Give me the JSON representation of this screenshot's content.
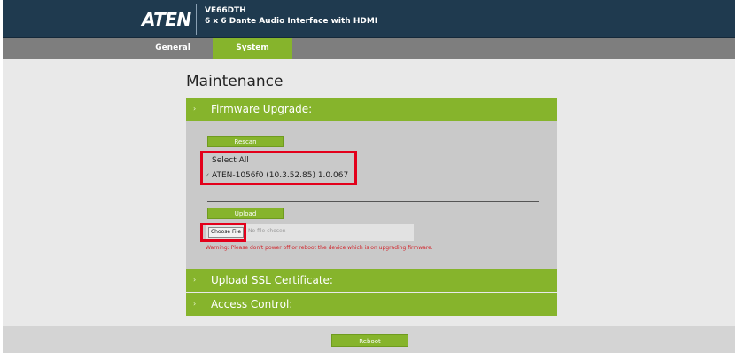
{
  "header": {
    "logo_text": "ATEN",
    "product_model": "VE66DTH",
    "product_desc": "6 x 6 Dante Audio Interface with HDMI"
  },
  "nav": {
    "tabs": [
      {
        "label": "General"
      },
      {
        "label": "System",
        "active": true
      }
    ]
  },
  "main": {
    "page_title": "Maintenance",
    "firmware": {
      "header": "Firmware Upgrade:",
      "rescan_label": "Rescan",
      "select_all_label": "Select All",
      "device_label": "ATEN-1056f0 (10.3.52.85) 1.0.067",
      "upload_label": "Upload",
      "choose_file_label": "Choose File",
      "no_file_text": "No file chosen",
      "warning": "Warning: Please don't power off or reboot the device which is on upgrading firmware."
    },
    "ssl": {
      "header": "Upload SSL Certificate:"
    },
    "access": {
      "header": "Access Control:"
    }
  },
  "footer": {
    "reboot_label": "Reboot"
  },
  "colors": {
    "header_bg": "#1f3a4f",
    "accent_green": "#86b42c",
    "highlight_red": "#e3001b",
    "warning_red": "#d2232a"
  }
}
